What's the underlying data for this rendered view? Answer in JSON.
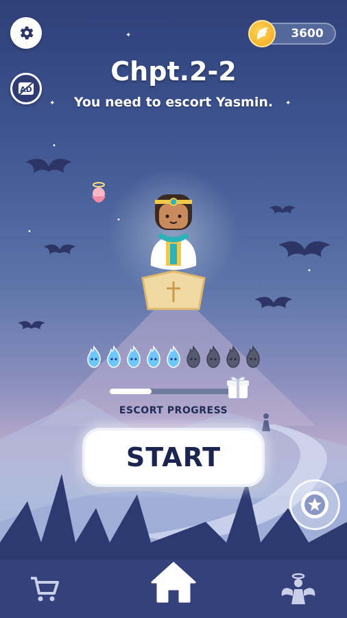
{
  "header": {
    "coins": "3600",
    "chapter_title": "Chpt.2-2",
    "mission_text": "You need to escort Yasmin."
  },
  "escort": {
    "label": "ESCORT PROGRESS",
    "progress_fraction": 0.34,
    "spirits_total": 9,
    "spirits_collected": 5
  },
  "start_button": {
    "label": "START"
  },
  "icons": {
    "settings": "gear-icon",
    "ad": "ad-icon",
    "coin": "wing-coin-icon",
    "gift": "gift-icon",
    "badge": "award-icon",
    "shop": "shopping-cart-icon",
    "home": "home-icon",
    "angel": "angel-icon"
  },
  "colors": {
    "accent": "#1c2550",
    "spirit_active": "#6ec8ff",
    "spirit_inactive": "#555a70",
    "nav_bg": "#34417a"
  }
}
